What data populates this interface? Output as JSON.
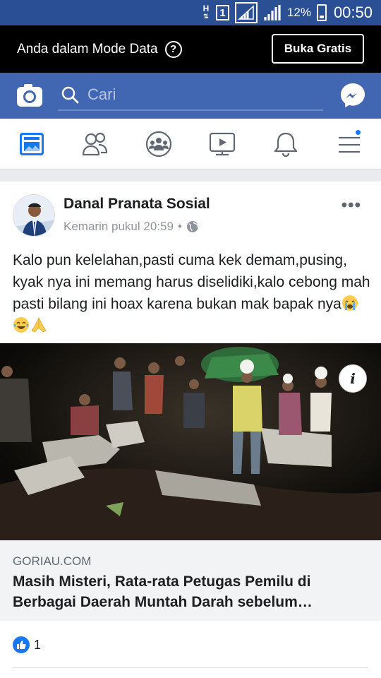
{
  "status_bar": {
    "network_letter": "H",
    "sim_number": "1",
    "battery_percent": "12%",
    "time": "00:50"
  },
  "data_banner": {
    "text": "Anda dalam Mode Data",
    "help_icon": "?",
    "button_label": "Buka Gratis"
  },
  "top_bar": {
    "search_placeholder": "Cari",
    "icons": [
      "camera-icon",
      "search-icon",
      "messenger-icon"
    ],
    "color": "#4267b2"
  },
  "nav": {
    "items": [
      "news-feed-icon",
      "friends-icon",
      "groups-icon",
      "watch-icon",
      "notifications-icon",
      "menu-icon"
    ],
    "active": "news-feed-icon",
    "accent": "#1877f2"
  },
  "post": {
    "author": "Danal Pranata Sosial",
    "timestamp": "Kemarin pukul 20:59",
    "separator": "•",
    "privacy_icon": "globe-icon",
    "text": "Kalo pun kelelahan,pasti cuma kek demam,pusing, kyak nya ini memang harus diselidiki,kalo cebong mah pasti bilang ini hoax karena bukan mak bapak nya",
    "emojis": [
      "crying-face-emoji",
      "tears-of-joy-emoji",
      "folded-hands-emoji"
    ],
    "link": {
      "domain": "GORIAU.COM",
      "title": "Masih Misteri, Rata-rata Petugas Pemilu di Berbagai Daerah Muntah Darah sebelum…"
    },
    "reactions": {
      "icon": "like-icon",
      "count": "1"
    }
  }
}
